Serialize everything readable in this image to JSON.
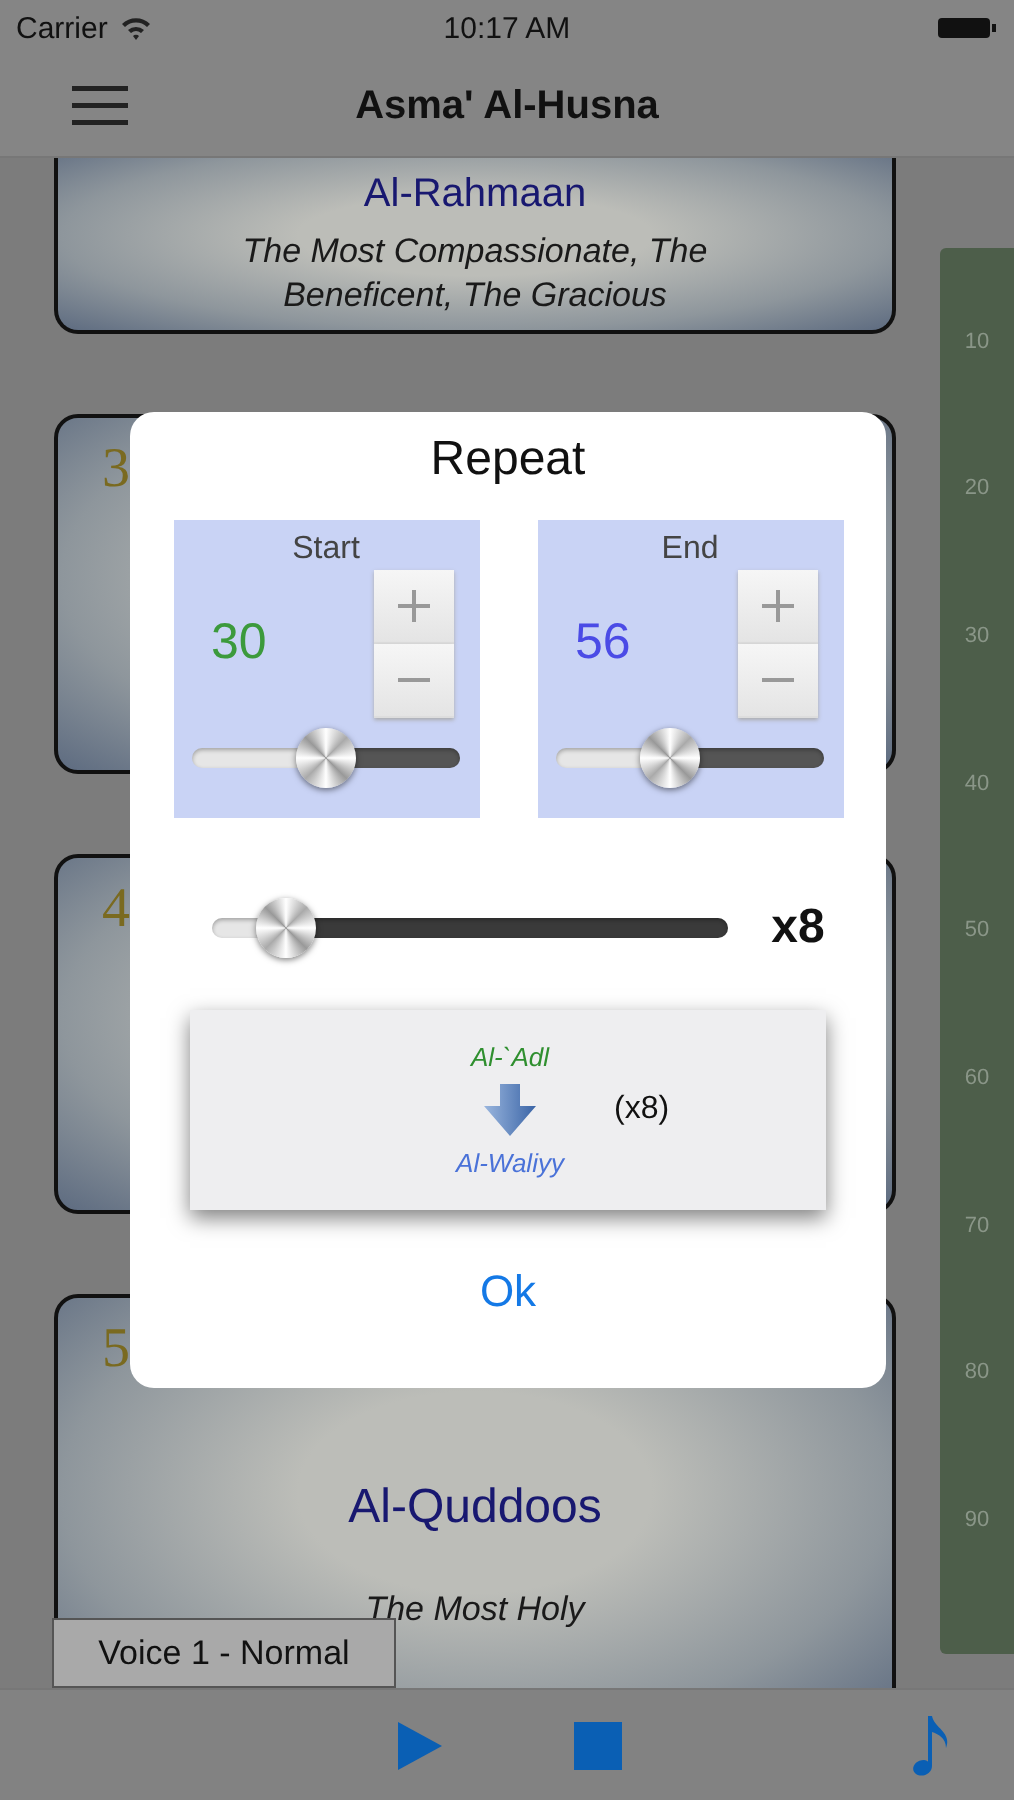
{
  "status_bar": {
    "carrier": "Carrier",
    "time": "10:17 AM"
  },
  "nav_bar": {
    "title": "Asma' Al-Husna"
  },
  "cards": [
    {
      "name": "Al-Rahmaan",
      "meaning": "The Most Compassionate, The Beneficent, The Gracious"
    },
    {
      "number": "3"
    },
    {
      "number": "4"
    },
    {
      "number": "5",
      "name": "Al-Quddoos",
      "meaning": "The Most Holy"
    }
  ],
  "index_bar": [
    "10",
    "20",
    "30",
    "40",
    "50",
    "60",
    "70",
    "80",
    "90"
  ],
  "voice_label": "Voice 1 - Normal",
  "repeat_dialog": {
    "title": "Repeat",
    "ranges": [
      {
        "label": "Start",
        "value": "30",
        "color": "#3c9a3c",
        "level": 0.5
      },
      {
        "label": "End",
        "value": "56",
        "color": "#4b4be6",
        "level": 0.4
      }
    ],
    "count": {
      "level": 0.1,
      "label": "x8"
    },
    "preview": {
      "from": "Al-`Adl",
      "to": "Al-Waliyy",
      "count": "(x8)"
    },
    "button": "Ok"
  }
}
